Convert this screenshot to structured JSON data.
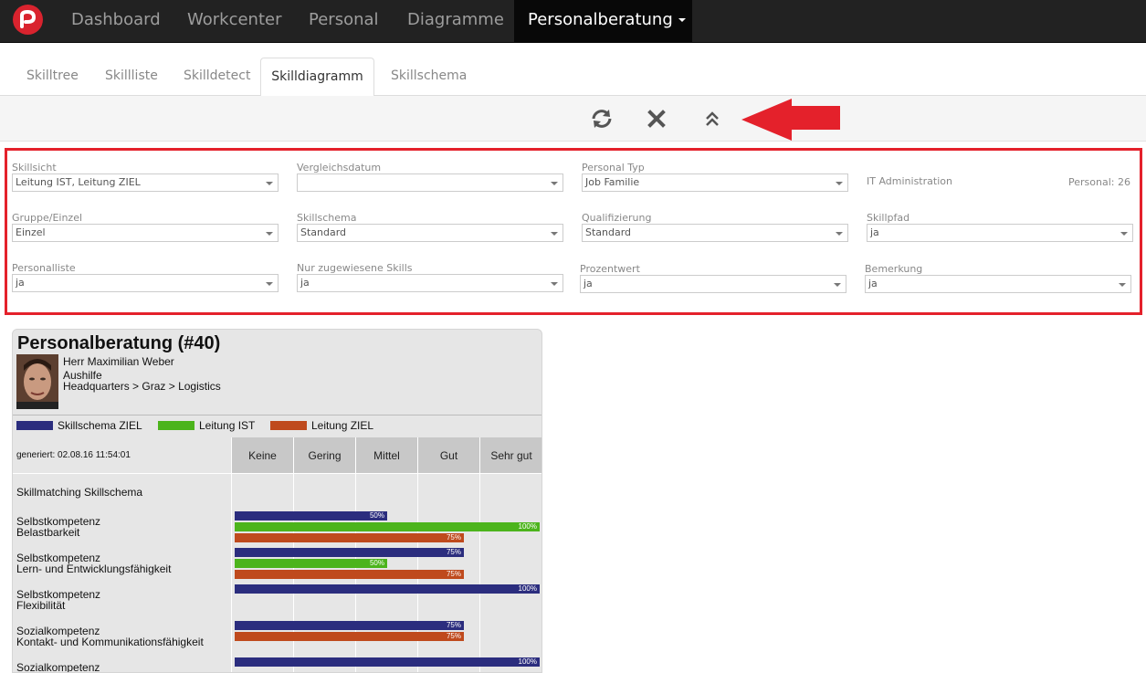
{
  "nav": {
    "items": [
      "Dashboard",
      "Workcenter",
      "Personal",
      "Diagramme"
    ],
    "active": "Personalberatung"
  },
  "tabs": [
    "Skilltree",
    "Skillliste",
    "Skilldetect",
    "Skilldiagramm",
    "Skillschema"
  ],
  "toolbar": {
    "icons": [
      "refresh-icon",
      "close-icon",
      "collapse-up-icon"
    ]
  },
  "filters": {
    "skillsicht": {
      "label": "Skillsicht",
      "value": "Leitung IST, Leitung ZIEL"
    },
    "vergleichsdatum": {
      "label": "Vergleichsdatum",
      "value": ""
    },
    "personal_typ": {
      "label": "Personal Typ",
      "value": "Job Familie"
    },
    "it_admin": "IT Administration",
    "personal_count": "Personal: 26",
    "gruppe": {
      "label": "Gruppe/Einzel",
      "value": "Einzel"
    },
    "skillschema": {
      "label": "Skillschema",
      "value": "Standard"
    },
    "qualifizierung": {
      "label": "Qualifizierung",
      "value": "Standard"
    },
    "skillpfad": {
      "label": "Skillpfad",
      "value": "ja"
    },
    "personalliste": {
      "label": "Personalliste",
      "value": "ja"
    },
    "nur_skills": {
      "label": "Nur zugewiesene Skills",
      "value": "ja"
    },
    "prozentwert": {
      "label": "Prozentwert",
      "value": "ja"
    },
    "bemerkung": {
      "label": "Bemerkung",
      "value": "ja"
    }
  },
  "report": {
    "title": "Personalberatung (#40)",
    "person_name": "Herr Maximilian Weber",
    "person_role": "Aushilfe",
    "person_path": "Headquarters > Graz > Logistics",
    "legend": [
      {
        "label": "Skillschema ZIEL",
        "color": "#2b2d7e"
      },
      {
        "label": "Leitung IST",
        "color": "#4cb41c"
      },
      {
        "label": "Leitung ZIEL",
        "color": "#bf4a1d"
      }
    ],
    "generated": "generiert: 02.08.16 11:54:01",
    "levels": [
      "Keine",
      "Gering",
      "Mittel",
      "Gut",
      "Sehr gut"
    ],
    "rows": [
      {
        "l1": "Skillmatching Skillschema",
        "l2": "",
        "bars": []
      },
      {
        "l1": "Selbstkompetenz",
        "l2": "Belastbarkeit",
        "bars": [
          {
            "series": "Skillschema ZIEL",
            "value": 50,
            "label": "50%"
          },
          {
            "series": "Leitung IST",
            "value": 100,
            "label": "100%"
          },
          {
            "series": "Leitung ZIEL",
            "value": 75,
            "label": "75%"
          }
        ]
      },
      {
        "l1": "Selbstkompetenz",
        "l2": "Lern- und Entwicklungsfähigkeit",
        "bars": [
          {
            "series": "Skillschema ZIEL",
            "value": 75,
            "label": "75%"
          },
          {
            "series": "Leitung IST",
            "value": 50,
            "label": "50%"
          },
          {
            "series": "Leitung ZIEL",
            "value": 75,
            "label": "75%"
          }
        ]
      },
      {
        "l1": "Selbstkompetenz",
        "l2": "Flexibilität",
        "bars": [
          {
            "series": "Skillschema ZIEL",
            "value": 100,
            "label": "100%"
          }
        ]
      },
      {
        "l1": "Sozialkompetenz",
        "l2": "Kontakt- und Kommunikationsfähigkeit",
        "bars": [
          {
            "series": "Skillschema ZIEL",
            "value": 75,
            "label": "75%"
          },
          {
            "series": "Leitung ZIEL",
            "value": 75,
            "label": "75%"
          }
        ]
      },
      {
        "l1": "Sozialkompetenz",
        "l2": "",
        "bars": [
          {
            "series": "Skillschema ZIEL",
            "value": 100,
            "label": "100%"
          }
        ]
      }
    ]
  }
}
